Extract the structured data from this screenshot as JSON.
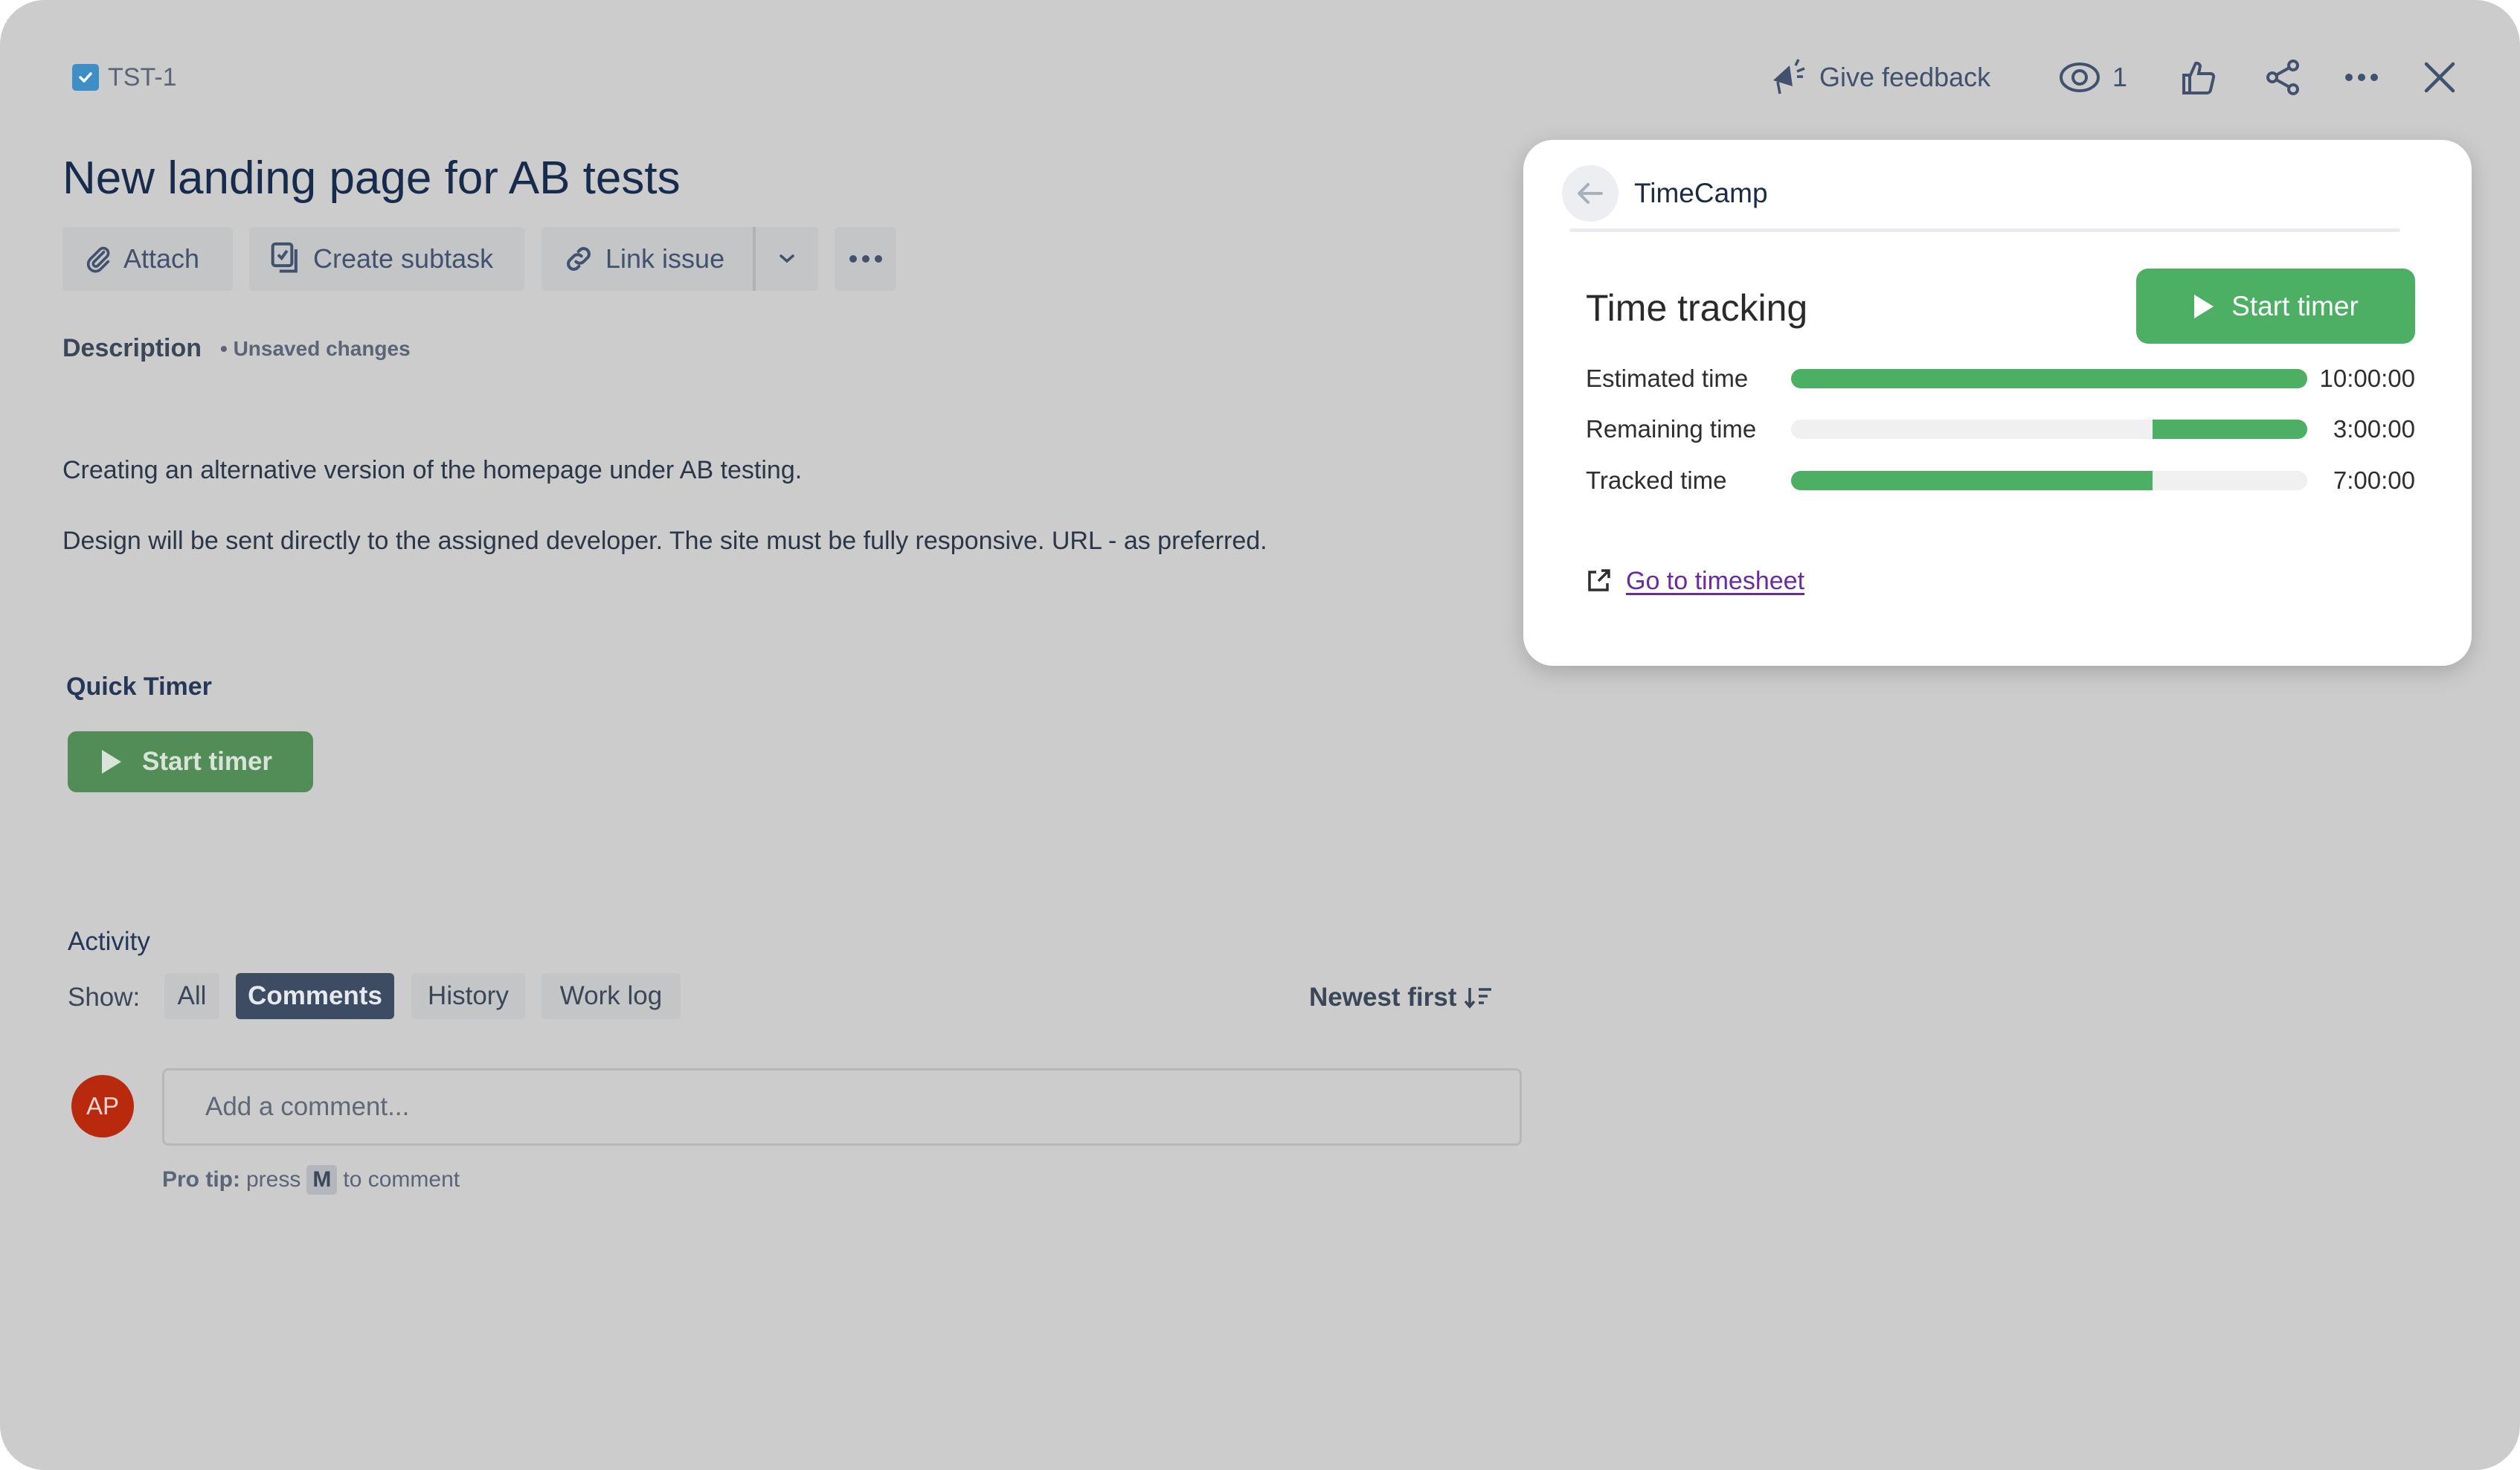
{
  "issue": {
    "key": "TST-1",
    "title": "New landing page for AB tests"
  },
  "toolbar": {
    "attach": "Attach",
    "create_subtask": "Create subtask",
    "link_issue": "Link issue"
  },
  "top_actions": {
    "give_feedback": "Give feedback",
    "watchers_count": "1"
  },
  "description": {
    "label": "Description",
    "status": "• Unsaved changes",
    "paragraphs": [
      "Creating an alternative version of the homepage under AB testing.",
      "Design will be sent directly to the assigned developer. The site must be fully responsive. URL - as preferred."
    ]
  },
  "quick_timer": {
    "label": "Quick Timer",
    "button": "Start timer"
  },
  "activity": {
    "label": "Activity",
    "show_label": "Show:",
    "tabs": [
      {
        "label": "All",
        "active": false
      },
      {
        "label": "Comments",
        "active": true
      },
      {
        "label": "History",
        "active": false
      },
      {
        "label": "Work log",
        "active": false
      }
    ],
    "sort": "Newest first",
    "avatar_initials": "AP",
    "avatar_color": "#b8290e",
    "comment_placeholder": "Add a comment...",
    "protip_bold": "Pro tip:",
    "protip_pre": "press",
    "protip_key": "M",
    "protip_post": "to comment"
  },
  "timecamp": {
    "app_name": "TimeCamp",
    "section_title": "Time tracking",
    "start_button": "Start timer",
    "accent_color": "#4caf64",
    "rows": [
      {
        "label": "Estimated time",
        "value": "10:00:00",
        "fill_fraction": 1.0,
        "align": "left"
      },
      {
        "label": "Remaining time",
        "value": "3:00:00",
        "fill_fraction": 0.3,
        "align": "right"
      },
      {
        "label": "Tracked time",
        "value": "7:00:00",
        "fill_fraction": 0.7,
        "align": "left"
      }
    ],
    "timesheet_link": "Go to timesheet"
  }
}
